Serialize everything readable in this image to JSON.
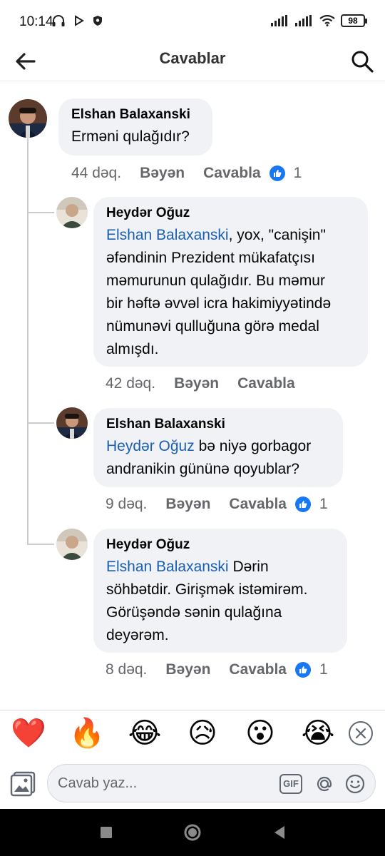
{
  "status_bar": {
    "time": "10:14",
    "battery": "98"
  },
  "header": {
    "title": "Cavablar"
  },
  "comments": [
    {
      "author": "Elshan Balaxanski",
      "text": "Erməni qulağıdır?",
      "time": "44 dəq.",
      "like_label": "Bəyən",
      "reply_label": "Cavabla",
      "reaction_count": "1"
    },
    {
      "author": "Heydər Oğuz",
      "mention": "Elshan Balaxanski",
      "text_lines": [
        ", yox, \"canişin\"",
        "əfəndinin Prezident mükafatçısı",
        "məmurunun qulağıdır. Bu məmur",
        "bir həftə əvvəl icra hakimiyyətində",
        "nümunəvi qulluğuna görə medal",
        "almışdı."
      ],
      "time": "42 dəq.",
      "like_label": "Bəyən",
      "reply_label": "Cavabla"
    },
    {
      "author": "Elshan Balaxanski",
      "mention": "Heydər Oğuz",
      "text_lines": [
        " bə niyə gorbagor",
        "andranikin gününə qoyublar?"
      ],
      "time": "9 dəq.",
      "like_label": "Bəyən",
      "reply_label": "Cavabla",
      "reaction_count": "1"
    },
    {
      "author": "Heydər Oğuz",
      "mention": "Elshan Balaxanski",
      "text_lines": [
        " Dərin",
        "söhbətdir. Girişmək istəmirəm.",
        "Görüşəndə sənin qulağına",
        "deyərəm."
      ],
      "time": "8 dəq.",
      "like_label": "Bəyən",
      "reply_label": "Cavabla",
      "reaction_count": "1"
    }
  ],
  "emoji_bar": {
    "emojis": [
      "❤️",
      "🔥",
      "😂",
      "😥",
      "😮",
      "😭"
    ]
  },
  "composer": {
    "placeholder": "Cavab yaz...",
    "gif_label": "GIF"
  },
  "colors": {
    "accent": "#1877f2",
    "mention": "#1a5fb4",
    "bubble": "#f0f2f5",
    "meta": "#65676b"
  }
}
